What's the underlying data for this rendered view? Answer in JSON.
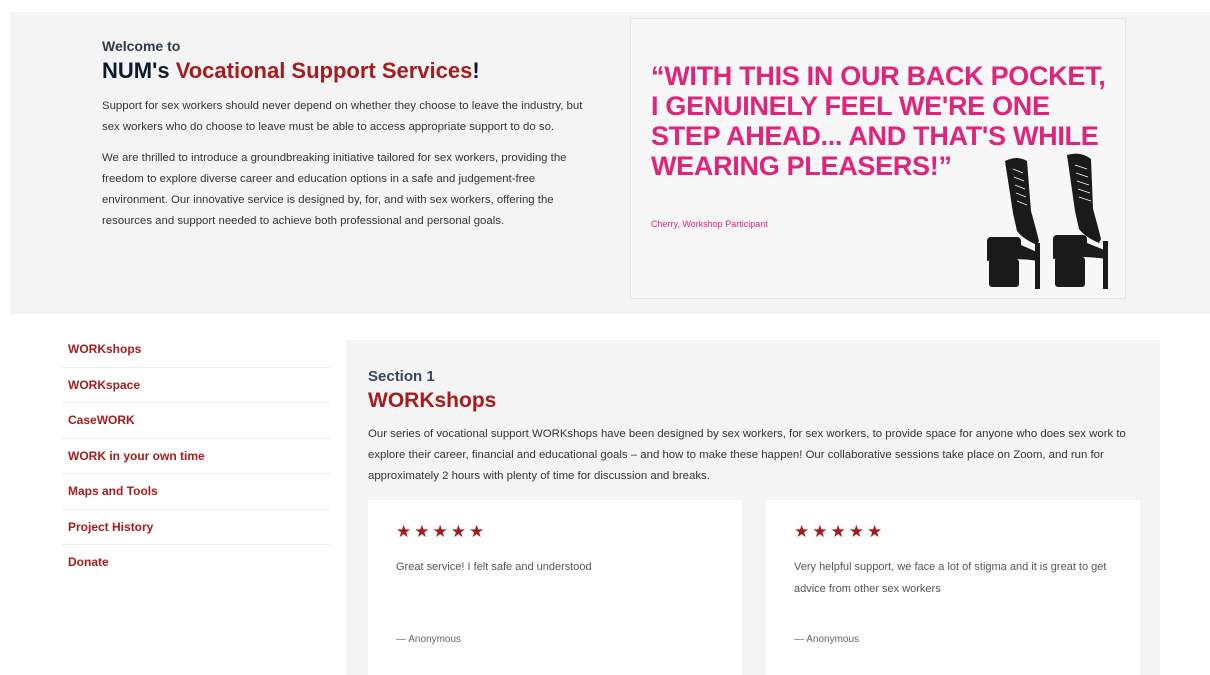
{
  "hero": {
    "kicker": "Welcome to",
    "title_prefix": "NUM's ",
    "title_accent": "Vocational Support Services",
    "title_suffix": "!",
    "paragraphs": [
      "Support for sex workers should never depend on whether they choose to leave the industry, but sex workers who do choose to leave must be able to access appropriate support to do so.",
      "We are thrilled to introduce a groundbreaking initiative tailored for sex workers, providing the freedom to explore diverse career and education options in a safe and judgement-free environment. Our innovative service is designed by, for, and with sex workers, offering the resources and support needed to achieve both professional and personal goals."
    ],
    "quote": "“WITH THIS IN OUR BACK POCKET, I GENUINELY FEEL WE'RE ONE STEP AHEAD... AND THAT'S WHILE WEARING PLEASERS!”",
    "quote_attribution": "Cherry, Workshop Participant",
    "quote_color": "#e0247c",
    "image_icon": "platform-boots-illustration"
  },
  "sidebar": {
    "items": [
      {
        "label": "WORKshops"
      },
      {
        "label": "WORKspace"
      },
      {
        "label": "CaseWORK"
      },
      {
        "label": "WORK in your own time"
      },
      {
        "label": "Maps and Tools"
      },
      {
        "label": "Project History"
      },
      {
        "label": "Donate"
      }
    ]
  },
  "section": {
    "number": "Section 1",
    "title": "WORKshops",
    "body": "Our series of vocational support WORKshops have been designed by sex workers, for sex workers, to provide space for anyone who does sex work to explore their career, financial and educational goals – and how to make these happen! Our collaborative sessions take place on Zoom, and run for approximately 2 hours with plenty of time for discussion and breaks."
  },
  "reviews": [
    {
      "stars": "★★★★★",
      "rating": 5,
      "text": "Great service! I felt safe and understood",
      "author": "— Anonymous"
    },
    {
      "stars": "★★★★★",
      "rating": 5,
      "text": "Very helpful support, we face a lot of stigma and it is great to get advice from other sex workers",
      "author": "— Anonymous"
    }
  ],
  "colors": {
    "accent": "#a51c1c",
    "pink": "#e0247c",
    "hero_bg": "#f4f4f4"
  }
}
